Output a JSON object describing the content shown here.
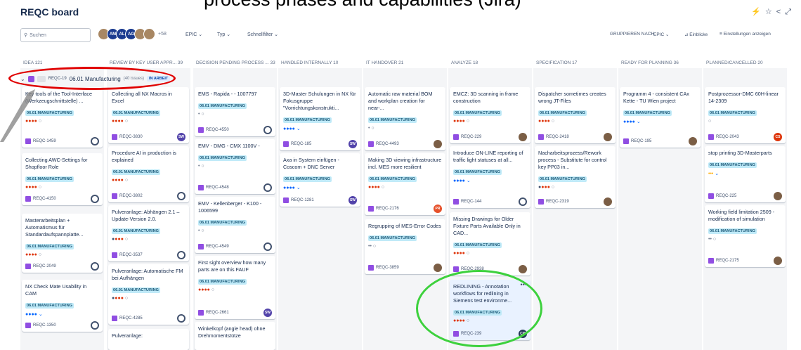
{
  "header": {
    "board_title": "REQC board",
    "overlay_title": "process phases and capabilities (Jira)"
  },
  "toolbar": {
    "search_placeholder": "Suchen",
    "more_avatars": "+58",
    "epic": "EPIC ⌄",
    "typ": "Typ ⌄",
    "schnellfilter": "Schnellfilter ⌄",
    "gruppieren": "GRUPPIEREN NACH",
    "gruppieren_value": "EPIC ⌄",
    "einblicke": "Einblicke",
    "einstellungen": "Einstellungen anzeigen"
  },
  "avatars": [
    "AM",
    "AL",
    "AG"
  ],
  "columns": [
    "IDEA 121",
    "REVIEW BY KEY USER APPR... 39",
    "DECISION PENDING PROCESS ... 33",
    "HANDLED INTERNALLY 10",
    "IT HANDOVER 21",
    "ANALYZE 18",
    "SPECIFICATION 17",
    "READY FOR PLANNING 36",
    "PLANNED/CANCELLED 20"
  ],
  "swimlane": {
    "key": "REQC-19",
    "name": "06.01 Manufacturing",
    "count": "(40 issues)",
    "status": "IN ARBEIT"
  },
  "epic_label": "06.01 MANUFACTURING",
  "cards": [
    {
      "title": "Key tools of the Tool-Interface (Werkzeugschnittstelle) ...",
      "key": "REQC-1459"
    },
    {
      "title": "Collecting AWC-Settings for Shopfloor Role",
      "key": "REQC-4150"
    },
    {
      "title": "Masterarbeitsplan + Automatismus für Standardaufspannplatte...",
      "key": "REQC-2049"
    },
    {
      "title": "NX Check Mate Usability in CAM",
      "key": "REQC-1350"
    },
    {
      "title": "Collecting all NX Macros in Excel",
      "key": "REQC-3830",
      "av": "SW"
    },
    {
      "title": "Procedure AI in production is explained",
      "key": "REQC-3802"
    },
    {
      "title": "Pulveranlage: Abhängen 2.1 – Update-Version 2.0.",
      "key": "REQC-3537"
    },
    {
      "title": "Pulveranlage: Automatische FM bei Aufhängen",
      "key": "REQC-4285"
    },
    {
      "title": "Pulveranlage:",
      "key": ""
    },
    {
      "title": "EMS - Rapida - - 1007797",
      "key": "REQC-4550"
    },
    {
      "title": "EMV - DMG - CMX 1100V -",
      "key": "REQC-4548"
    },
    {
      "title": "EMV - Kellenberger - K100 - 1006599",
      "key": "REQC-4549"
    },
    {
      "title": "First sight overview how many parts are on this FAUF",
      "key": "REQC-2661",
      "av": "SW"
    },
    {
      "title": "Winkelkopf (angle head) ohne Drehmomentstütze",
      "key": ""
    },
    {
      "title": "3D-Master Schulungen in NX für Fokusgruppe \"Vorrichtungskonstrukti...",
      "key": "REQC-185",
      "av": "SW"
    },
    {
      "title": "Axa in System einfügen - Coscom + DNC Server",
      "key": "REQC-1281",
      "av": "SW"
    },
    {
      "title": "Automatic raw material BOM and workplan creation for near-...",
      "key": "REQC-4493"
    },
    {
      "title": "Making 3D viewing infrastructure incl. MES more resilient",
      "key": "REQC-2176",
      "av": "PR"
    },
    {
      "title": "Regrupping of MES-Error Codes",
      "key": "REQC-3859"
    },
    {
      "title": "EMCZ: 3D scanning in frame construction",
      "key": "REQC-229"
    },
    {
      "title": "Introduce ON-LINE reporting of traffic light statuses at all...",
      "key": "REQC-144"
    },
    {
      "title": "Missing Drawings for Older Fixture Parts Available Only in CAD...",
      "key": "REQC-2938"
    },
    {
      "title": "REDLINING - Annotation workflows for redlining in Siemens test environme...",
      "key": "REQC-239",
      "av": "CM"
    },
    {
      "title": "Dispatcher sometimes creates wrong JT-Files",
      "key": "REQC-2418"
    },
    {
      "title": "Nacharbeitsprozess/Rework process - Substitute for control key PP03 in...",
      "key": "REQC-2319"
    },
    {
      "title": "Programm 4 - consistent CAx Kette - TU Wien project",
      "key": "REQC-195"
    },
    {
      "title": "Postprozessor-DMC 60H-linear 14-2309",
      "key": "REQC-2043",
      "av": "CS"
    },
    {
      "title": "stop printing 3D-Masterparts",
      "key": "REQC-225"
    },
    {
      "title": "Working field limitation 2509 - modification of simulation",
      "key": "REQC-2175"
    }
  ]
}
